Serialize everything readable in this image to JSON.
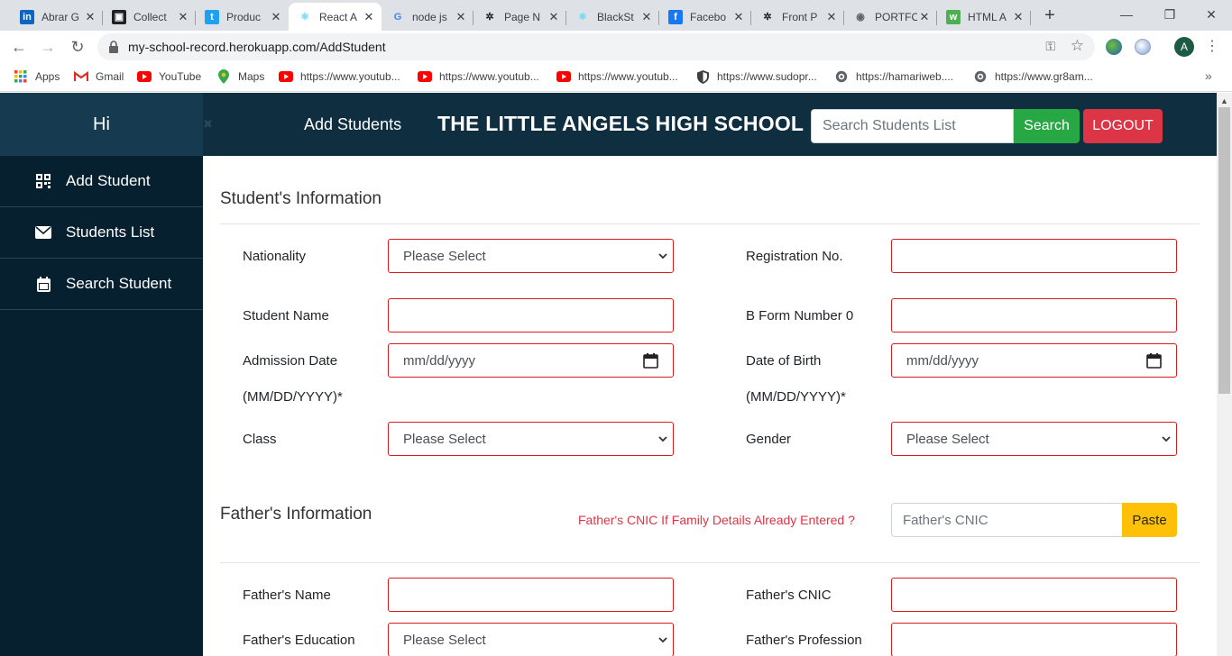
{
  "browser": {
    "tabs": [
      {
        "title": "Abrar G",
        "icon": "linkedin-icon",
        "color": "#0a66c2",
        "glyph": "in"
      },
      {
        "title": "Collect",
        "icon": "notion-icon",
        "color": "#202124",
        "glyph": "▣"
      },
      {
        "title": "Produc",
        "icon": "twitter-icon",
        "color": "#1da1f2",
        "glyph": "t"
      },
      {
        "title": "React A",
        "icon": "react-icon",
        "color": "#61dafb",
        "glyph": "⚛"
      },
      {
        "title": "node js",
        "icon": "google-icon",
        "color": "#4285f4",
        "glyph": "G"
      },
      {
        "title": "Page N",
        "icon": "bird-icon",
        "color": "#202124",
        "glyph": "✲"
      },
      {
        "title": "BlackSt",
        "icon": "react-icon",
        "color": "#61dafb",
        "glyph": "⚛"
      },
      {
        "title": "Facebo",
        "icon": "facebook-icon",
        "color": "#1877f2",
        "glyph": "f"
      },
      {
        "title": "Front P",
        "icon": "bird-icon",
        "color": "#202124",
        "glyph": "✲"
      },
      {
        "title": "PORTFO",
        "icon": "globe-icon",
        "color": "#5f6368",
        "glyph": "◉"
      },
      {
        "title": "HTML A",
        "icon": "w3-icon",
        "color": "#4caf50",
        "glyph": "w"
      }
    ],
    "new_tab": "+",
    "window_controls": {
      "minimize": "—",
      "restore": "❐",
      "close": "✕"
    },
    "url": "my-school-record.herokuapp.com/AddStudent",
    "avatar_letter": "A",
    "bookmarks": [
      {
        "label": "Apps",
        "icon": "apps-grid-icon"
      },
      {
        "label": "Gmail",
        "icon": "gmail-icon"
      },
      {
        "label": "YouTube",
        "icon": "youtube-icon"
      },
      {
        "label": "Maps",
        "icon": "maps-pin-icon"
      },
      {
        "label": "https://www.youtub...",
        "icon": "youtube-icon"
      },
      {
        "label": "https://www.youtub...",
        "icon": "youtube-icon"
      },
      {
        "label": "https://www.youtub...",
        "icon": "youtube-icon"
      },
      {
        "label": "https://www.sudopr...",
        "icon": "shield-icon"
      },
      {
        "label": "https://hamariweb....",
        "icon": "globe-icon"
      },
      {
        "label": "https://www.gr8am...",
        "icon": "globe-icon"
      }
    ],
    "bookmarks_more": "»"
  },
  "app": {
    "greeting": "Hi",
    "greeting_close": "✖",
    "nav_link": "Add Students",
    "school_name": "THE LITTLE ANGELS HIGH SCHOOL",
    "search_placeholder": "Search Students List",
    "search_button": "Search",
    "logout_button": "LOGOUT",
    "colors": {
      "navbar": "#0f2e40",
      "sidebar": "#07202f",
      "search": "#28a745",
      "logout": "#dc3545",
      "paste": "#ffc107",
      "field_border": "#d81b1b"
    }
  },
  "sidebar": {
    "items": [
      {
        "label": "Add Student",
        "icon": "qr-grid-icon"
      },
      {
        "label": "Students List",
        "icon": "envelope-icon"
      },
      {
        "label": "Search Student",
        "icon": "calendar-icon"
      }
    ]
  },
  "form": {
    "student_section": "Student's Information",
    "nationality_label": "Nationality",
    "nationality_value": "Please Select",
    "registration_label": "Registration No.",
    "registration_value": "",
    "student_name_label": "Student Name",
    "student_name_value": "",
    "bform_label": "B Form Number 0",
    "bform_value": "",
    "admission_label": "Admission Date",
    "admission_format": "(MM/DD/YYYY)*",
    "admission_value": "mm/dd/yyyy",
    "dob_label": "Date of Birth",
    "dob_format": "(MM/DD/YYYY)*",
    "dob_value": "mm/dd/yyyy",
    "class_label": "Class",
    "class_value": "Please Select",
    "gender_label": "Gender",
    "gender_value": "Please Select",
    "father_section": "Father's Information",
    "cnic_hint": "Father's CNIC If Family Details Already Entered ?",
    "cnic_search_placeholder": "Father's CNIC",
    "paste_button": "Paste",
    "father_name_label": "Father's Name",
    "father_name_value": "",
    "father_cnic_label": "Father's CNIC",
    "father_cnic_value": "",
    "father_education_label": "Father's Education",
    "father_education_value": "Please Select",
    "father_profession_label": "Father's Profession",
    "father_profession_value": ""
  }
}
